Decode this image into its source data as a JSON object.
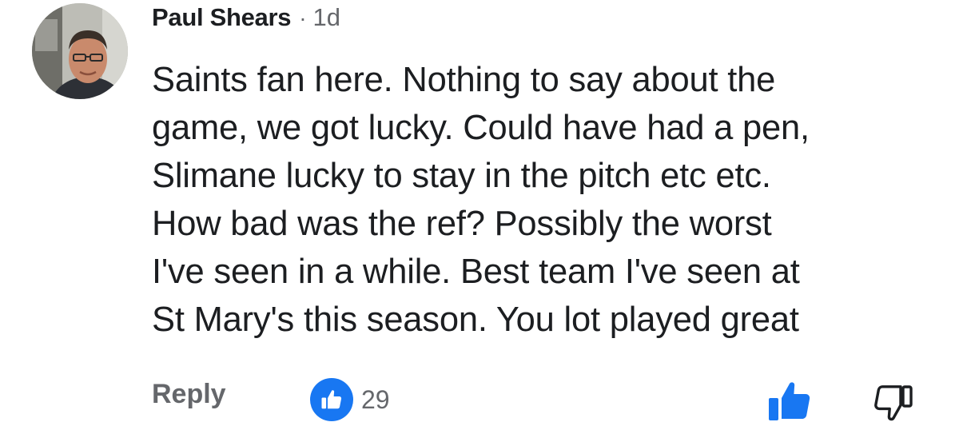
{
  "comment": {
    "author": "Paul Shears",
    "separator": "·",
    "time": "1d",
    "lines": [
      "Saints fan here. Nothing to say about the",
      "game, we got lucky. Could have had a pen,",
      "Slimane lucky to stay in the pitch etc etc.",
      "How bad was the ref? Possibly the worst",
      "I've seen in a while. Best team I've seen at",
      "St Mary's this season. You lot played great"
    ],
    "reply_label": "Reply",
    "reaction_count": "29"
  },
  "icons": {
    "avatar": "avatar-photo",
    "reaction": "thumbs-up-icon",
    "like": "thumbs-up-icon",
    "dislike": "thumbs-down-icon"
  },
  "colors": {
    "accent": "#1877f2",
    "text": "#1c1e21",
    "muted": "#65676b"
  }
}
